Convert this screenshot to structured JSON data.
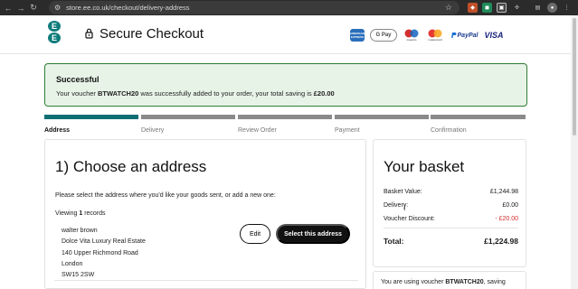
{
  "browser": {
    "url": "store.ee.co.uk/checkout/delivery-address"
  },
  "header": {
    "logo_letters": [
      "E",
      "E"
    ],
    "title": "Secure Checkout",
    "payment_methods": [
      "AMERICAN EXPRESS",
      "G Pay",
      "maestro",
      "mastercard",
      "PayPal",
      "VISA"
    ]
  },
  "alert": {
    "title": "Successful",
    "text_before": "Your voucher ",
    "voucher_code": "BTWATCH20",
    "text_middle": " was successfully added to your order, your total saving is ",
    "saving": "£20.00"
  },
  "steps": [
    {
      "label": "Address",
      "active": true
    },
    {
      "label": "Delivery",
      "active": false
    },
    {
      "label": "Review Order",
      "active": false
    },
    {
      "label": "Payment",
      "active": false
    },
    {
      "label": "Confirmation",
      "active": false
    }
  ],
  "address": {
    "heading": "1) Choose an address",
    "instruction": "Please select the address where you'd like your goods sent, or add a new one:",
    "viewing_prefix": "Viewing ",
    "viewing_count": "1",
    "viewing_suffix": " records",
    "lines": [
      "walter brown",
      "Dolce Vita Luxury Real Estate",
      "140 Upper Richmond Road",
      "London",
      "SW15 2SW"
    ],
    "edit_label": "Edit",
    "select_label": "Select this address"
  },
  "basket": {
    "heading": "Your basket",
    "rows": [
      {
        "label": "Basket Value:",
        "value": "£1,244.98"
      },
      {
        "label": "Delivery:",
        "value": "£0.00"
      },
      {
        "label": "Voucher Discount:",
        "value": "- £20.00"
      }
    ],
    "total_label": "Total:",
    "total_value": "£1,224.98",
    "voucher_note_prefix": "You are using voucher ",
    "voucher_note_code": "BTWATCH20",
    "voucher_note_suffix": ", saving"
  },
  "colors": {
    "brand_teal": "#0e7c7b",
    "success_border": "#2e7d32",
    "success_bg": "#e8f3e8",
    "discount_red": "#d32f2f"
  }
}
